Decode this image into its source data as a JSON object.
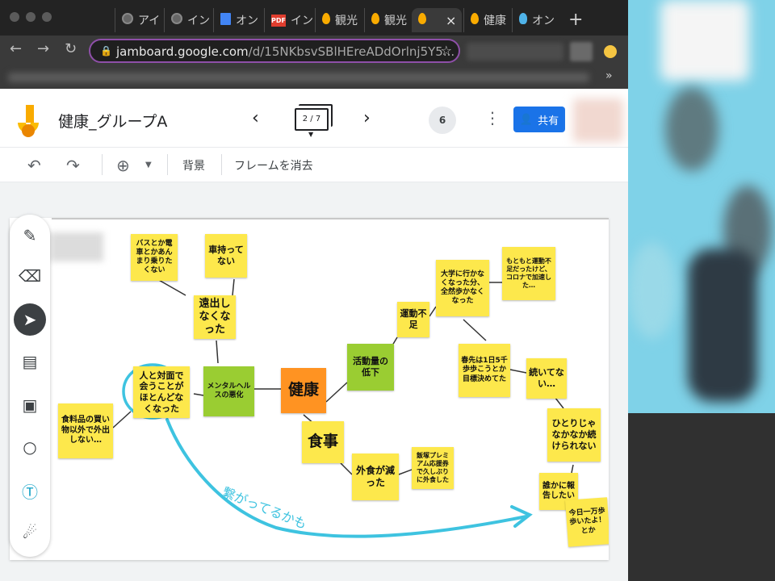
{
  "browser": {
    "tabs": [
      {
        "label": "アイ",
        "icon": "globe-icon"
      },
      {
        "label": "イン",
        "icon": "globe-icon"
      },
      {
        "label": "オン",
        "icon": "google-docs-icon"
      },
      {
        "label": "イン",
        "icon": "pdf-icon",
        "icon_text": "PDF"
      },
      {
        "label": "観光",
        "icon": "jamboard-icon"
      },
      {
        "label": "観光",
        "icon": "jamboard-icon"
      },
      {
        "label": "",
        "icon": "jamboard-icon",
        "active": true,
        "close": "×"
      },
      {
        "label": "健康",
        "icon": "jamboard-icon"
      },
      {
        "label": "オン",
        "icon": "lightbulb-icon"
      }
    ],
    "new_tab": "+",
    "url_host": "jamboard.google.com",
    "url_path": "/d/15NKbsvSBlHEreADdOrlnj5Y5...",
    "bookmarks_more": "»"
  },
  "header": {
    "title": "健康_グループA",
    "frame_indicator": "2 / 7",
    "collaborators": "6",
    "share_label": "共有"
  },
  "toolbar": {
    "background_label": "背景",
    "clear_frame_label": "フレームを消去"
  },
  "notes": [
    {
      "id": "n1",
      "text": "バスとか電車とかあんまり乗りたくない",
      "color": "yellow"
    },
    {
      "id": "n2",
      "text": "車持ってない",
      "color": "yellow"
    },
    {
      "id": "n3",
      "text": "遠出しなくなった",
      "color": "yellow"
    },
    {
      "id": "n4",
      "text": "人と対面で会うことがほとんどなくなった",
      "color": "yellow"
    },
    {
      "id": "n5",
      "text": "メンタルヘルスの悪化",
      "color": "green"
    },
    {
      "id": "n6",
      "text": "健康",
      "color": "orange"
    },
    {
      "id": "n7",
      "text": "活動量の低下",
      "color": "green"
    },
    {
      "id": "n8",
      "text": "運動不足",
      "color": "yellow"
    },
    {
      "id": "n9",
      "text": "大学に行かなくなった分、全然歩かなくなった",
      "color": "yellow"
    },
    {
      "id": "n10",
      "text": "もともと運動不足だったけど、コロナで加速した…",
      "color": "yellow"
    },
    {
      "id": "n11",
      "text": "春先は1日5千歩歩こうとか目標決めてた",
      "color": "yellow"
    },
    {
      "id": "n12",
      "text": "続いてない…",
      "color": "yellow"
    },
    {
      "id": "n13",
      "text": "ひとりじゃなかなか続けられない",
      "color": "yellow"
    },
    {
      "id": "n14",
      "text": "誰かに報告したい",
      "color": "yellow"
    },
    {
      "id": "n15",
      "text": "今日一万歩歩いたよ！とか",
      "color": "yellow"
    },
    {
      "id": "n16",
      "text": "食料品の買い物以外で外出しない…",
      "color": "yellow"
    },
    {
      "id": "n17",
      "text": "食事",
      "color": "yellow"
    },
    {
      "id": "n18",
      "text": "外食が減った",
      "color": "yellow"
    },
    {
      "id": "n19",
      "text": "飯塚プレミアム応援券で久しぶりに外食した",
      "color": "yellow"
    }
  ],
  "annotation": "繋がってるかも",
  "colors": {
    "sticky_yellow": "#fde84c",
    "sticky_green": "#9acd32",
    "sticky_orange": "#ff9322",
    "pen_cyan": "#3ec3e0",
    "share_blue": "#1a73e8"
  }
}
